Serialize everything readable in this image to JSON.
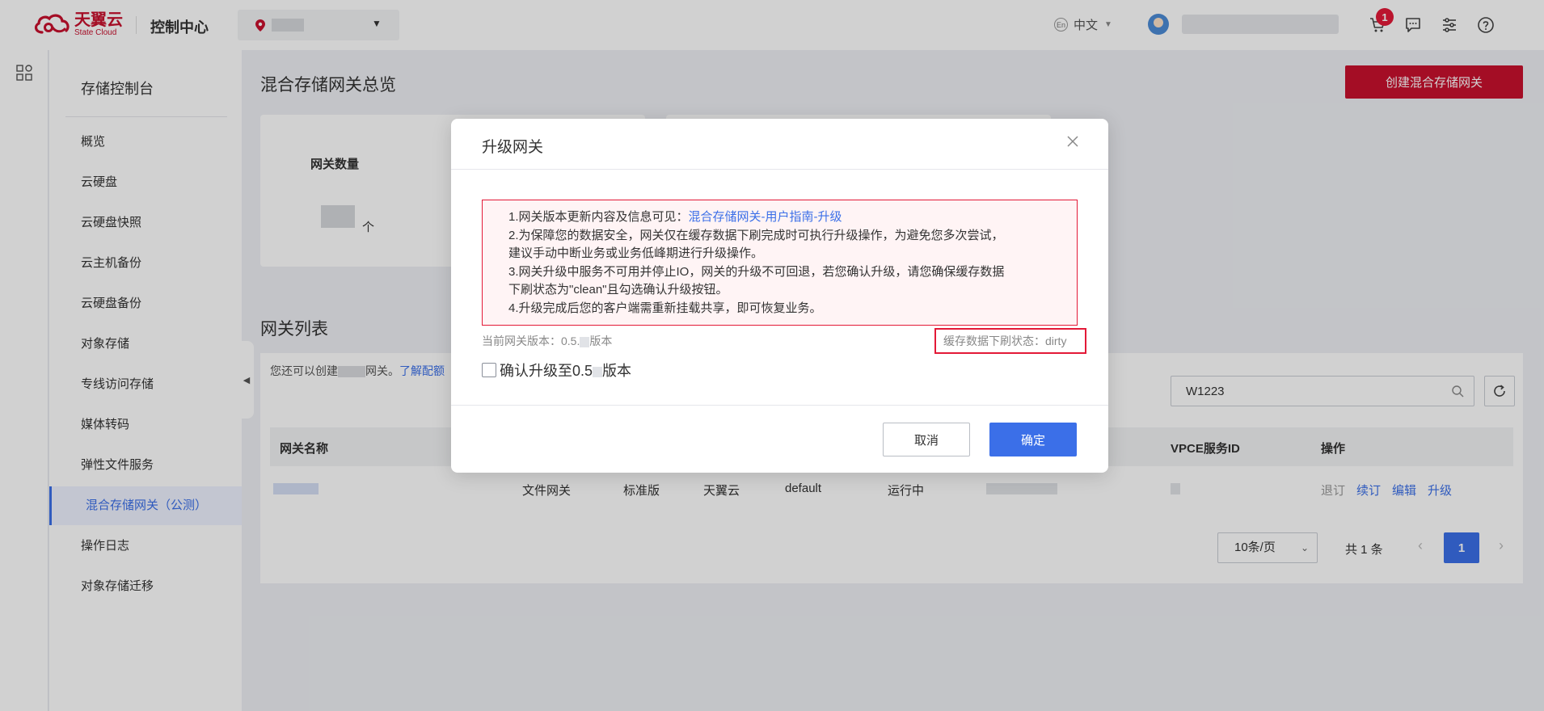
{
  "header": {
    "logo_cn": "天翼云",
    "logo_en": "State Cloud",
    "console_title": "控制中心",
    "language": "中文",
    "language_badge": "En",
    "cart_count": "1",
    "icons": [
      "location-pin-icon",
      "caret-down-icon",
      "cart-icon",
      "message-icon",
      "settings-sliders-icon",
      "help-icon"
    ],
    "brand_color": "#c8102e"
  },
  "sidebar": {
    "title": "存储控制台",
    "items": [
      {
        "label": "概览"
      },
      {
        "label": "云硬盘"
      },
      {
        "label": "云硬盘快照"
      },
      {
        "label": "云主机备份"
      },
      {
        "label": "云硬盘备份"
      },
      {
        "label": "对象存储"
      },
      {
        "label": "专线访问存储"
      },
      {
        "label": "媒体转码"
      },
      {
        "label": "弹性文件服务"
      },
      {
        "label": "混合存储网关（公测）",
        "active": true
      },
      {
        "label": "操作日志"
      },
      {
        "label": "对象存储迁移"
      }
    ],
    "active_color": "#3b6fe8"
  },
  "main": {
    "page_title": "混合存储网关总览",
    "create_button": "创建混合存储网关",
    "stat_card": {
      "label": "网关数量",
      "unit": "个"
    },
    "list_title": "网关列表",
    "tip_prefix": "您还可以创建",
    "tip_suffix": "网关。",
    "tip_link": "了解配额",
    "search": {
      "value": "W1223"
    },
    "table": {
      "columns": [
        "网关名称",
        "VPCE服务ID",
        "操作"
      ],
      "rows": [
        {
          "type": "文件网关",
          "edition": "标准版",
          "provider": "天翼云",
          "project": "default",
          "status": "运行中"
        }
      ],
      "row_actions": [
        "退订",
        "续订",
        "编辑",
        "升级"
      ]
    },
    "pagination": {
      "page_size": "10条/页",
      "total": "共 1 条",
      "current_page": "1",
      "prev": "‹",
      "next": "›"
    }
  },
  "modal": {
    "title": "升级网关",
    "notice": {
      "line1_prefix": "1.网关版本更新内容及信息可见：",
      "line1_link": "混合存储网关-用户指南-升级",
      "line2": "2.为保障您的数据安全，网关仅在缓存数据下刷完成时可执行升级操作，为避免您多次尝试，",
      "line3": "建议手动中断业务或业务低峰期进行升级操作。",
      "line4": "3.网关升级中服务不可用并停止IO，网关的升级不可回退，若您确认升级，请您确保缓存数据",
      "line5": "下刷状态为\"clean\"且勾选确认升级按钮。",
      "line6": "4.升级完成后您的客户端需重新挂载共享，即可恢复业务。"
    },
    "current_version_label": "当前网关版本：0.5.",
    "current_version_suffix": "版本",
    "cache_status": "缓存数据下刷状态：dirty",
    "confirm_prefix": "确认升级至0.5",
    "confirm_suffix": "版本",
    "confirm_checked": false,
    "cancel_button": "取消",
    "ok_button": "确定",
    "primary_color": "#3b6fe8",
    "warning_color": "#e31937"
  }
}
